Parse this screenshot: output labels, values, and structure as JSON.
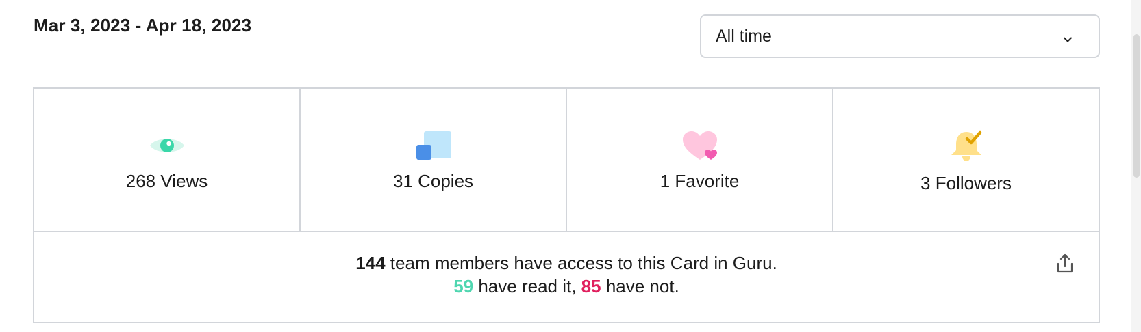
{
  "date_range": "Mar 3, 2023 - Apr 18, 2023",
  "time_filter": {
    "selected": "All time",
    "icon": "chevron-down-icon"
  },
  "stats": [
    {
      "count": "268",
      "label": "Views",
      "icon": "eye-icon"
    },
    {
      "count": "31",
      "label": "Copies",
      "icon": "copy-icon"
    },
    {
      "count": "1",
      "label": "Favorite",
      "icon": "heart-icon"
    },
    {
      "count": "3",
      "label": "Followers",
      "icon": "bell-check-icon"
    }
  ],
  "access": {
    "members_count": "144",
    "members_text": " team members have access to this Card in Guru.",
    "read_count": "59",
    "read_text": " have read it, ",
    "unread_count": "85",
    "unread_text": " have not.",
    "export_icon": "export-icon"
  },
  "colors": {
    "read": "#4fd6b0",
    "unread": "#e0205e",
    "border": "#d2d5da"
  }
}
